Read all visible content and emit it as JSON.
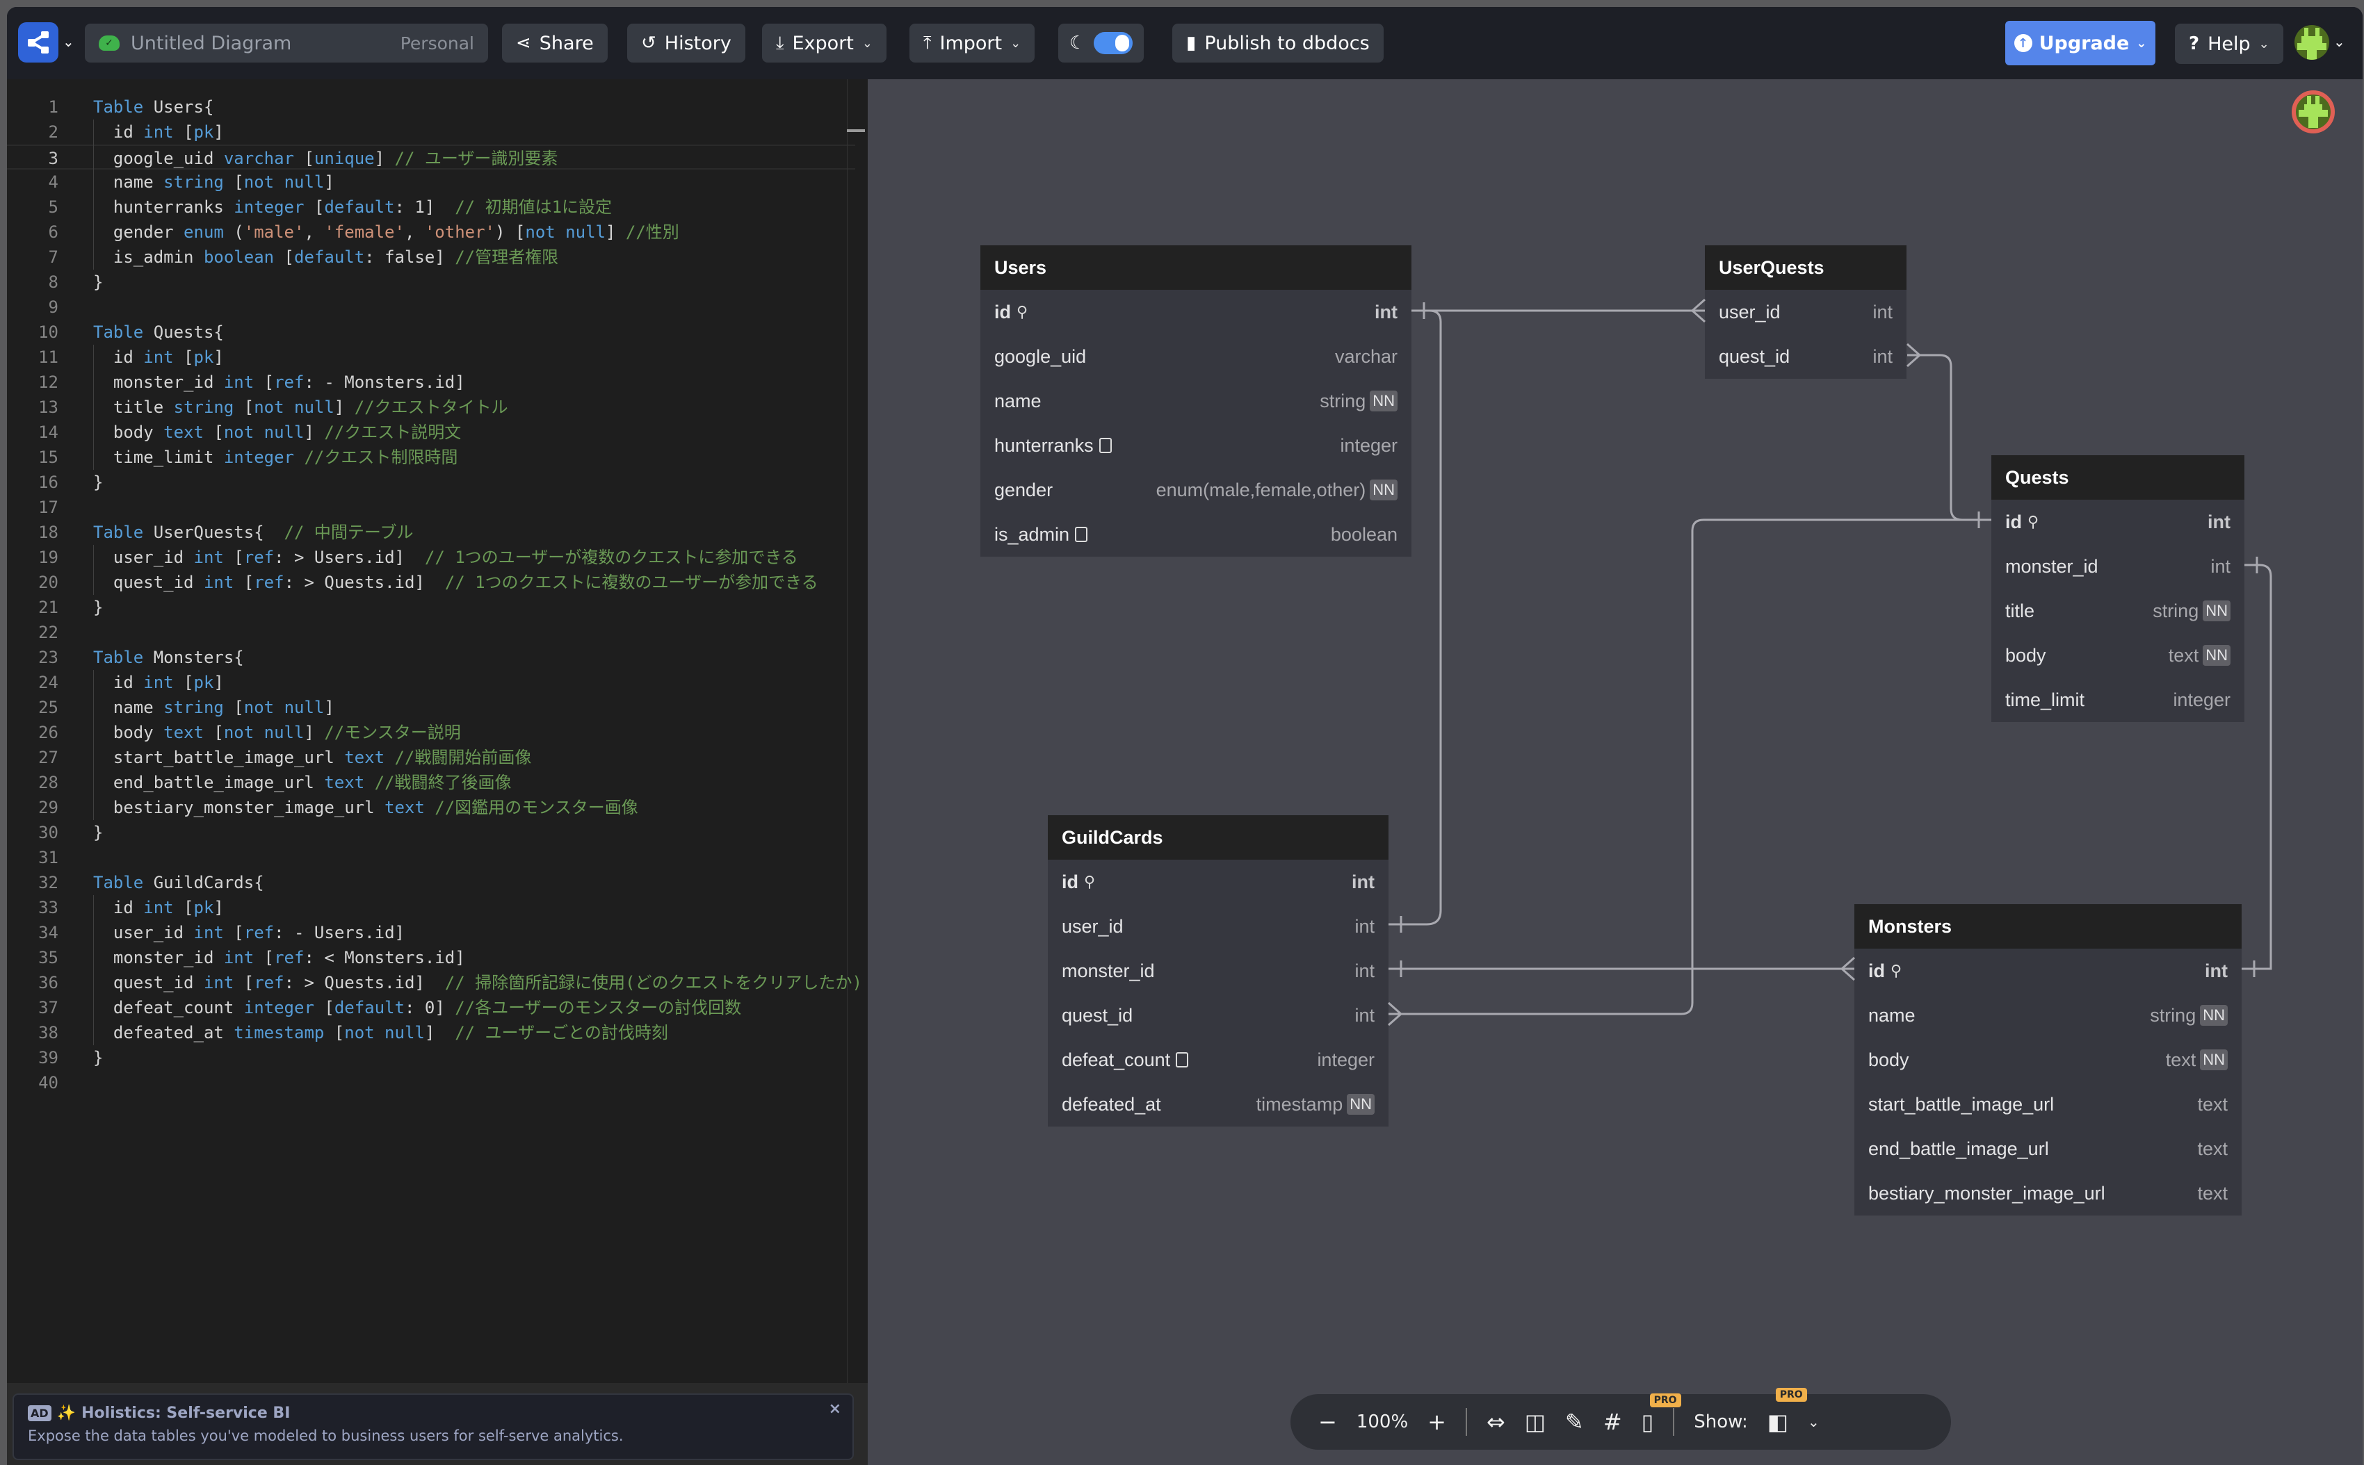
{
  "topbar": {
    "diagram_name": "Untitled Diagram",
    "workspace": "Personal",
    "share_label": "Share",
    "history_label": "History",
    "export_label": "Export",
    "import_label": "Import",
    "publish_label": "Publish to dbdocs",
    "upgrade_label": "Upgrade",
    "help_label": "Help",
    "dark_mode_on": true
  },
  "editor": {
    "current_line": 3,
    "lines": [
      [
        [
          "k",
          "Table"
        ],
        [
          "t",
          " Users{"
        ]
      ],
      [
        [
          "t",
          "  id "
        ],
        [
          "k",
          "int"
        ],
        [
          "t",
          " ["
        ],
        [
          "k",
          "pk"
        ],
        [
          "t",
          "]"
        ]
      ],
      [
        [
          "t",
          "  google_uid "
        ],
        [
          "k",
          "varchar"
        ],
        [
          "t",
          " ["
        ],
        [
          "k",
          "unique"
        ],
        [
          "t",
          "] "
        ],
        [
          "c",
          "// ユーザー識別要素"
        ]
      ],
      [
        [
          "t",
          "  name "
        ],
        [
          "k",
          "string"
        ],
        [
          "t",
          " ["
        ],
        [
          "k",
          "not null"
        ],
        [
          "t",
          "]"
        ]
      ],
      [
        [
          "t",
          "  hunterranks "
        ],
        [
          "k",
          "integer"
        ],
        [
          "t",
          " ["
        ],
        [
          "k",
          "default"
        ],
        [
          "t",
          ": 1]  "
        ],
        [
          "c",
          "// 初期値は1に設定"
        ]
      ],
      [
        [
          "t",
          "  gender "
        ],
        [
          "k",
          "enum"
        ],
        [
          "t",
          " ("
        ],
        [
          "s",
          "'male'"
        ],
        [
          "t",
          ", "
        ],
        [
          "s",
          "'female'"
        ],
        [
          "t",
          ", "
        ],
        [
          "s",
          "'other'"
        ],
        [
          "t",
          ") ["
        ],
        [
          "k",
          "not null"
        ],
        [
          "t",
          "] "
        ],
        [
          "c",
          "//性別"
        ]
      ],
      [
        [
          "t",
          "  is_admin "
        ],
        [
          "k",
          "boolean"
        ],
        [
          "t",
          " ["
        ],
        [
          "k",
          "default"
        ],
        [
          "t",
          ": false] "
        ],
        [
          "c",
          "//管理者権限"
        ]
      ],
      [
        [
          "t",
          "}"
        ]
      ],
      [],
      [
        [
          "k",
          "Table"
        ],
        [
          "t",
          " Quests{"
        ]
      ],
      [
        [
          "t",
          "  id "
        ],
        [
          "k",
          "int"
        ],
        [
          "t",
          " ["
        ],
        [
          "k",
          "pk"
        ],
        [
          "t",
          "]"
        ]
      ],
      [
        [
          "t",
          "  monster_id "
        ],
        [
          "k",
          "int"
        ],
        [
          "t",
          " ["
        ],
        [
          "k",
          "ref"
        ],
        [
          "t",
          ": - Monsters.id]"
        ]
      ],
      [
        [
          "t",
          "  title "
        ],
        [
          "k",
          "string"
        ],
        [
          "t",
          " ["
        ],
        [
          "k",
          "not null"
        ],
        [
          "t",
          "] "
        ],
        [
          "c",
          "//クエストタイトル"
        ]
      ],
      [
        [
          "t",
          "  body "
        ],
        [
          "k",
          "text"
        ],
        [
          "t",
          " ["
        ],
        [
          "k",
          "not null"
        ],
        [
          "t",
          "] "
        ],
        [
          "c",
          "//クエスト説明文"
        ]
      ],
      [
        [
          "t",
          "  time_limit "
        ],
        [
          "k",
          "integer"
        ],
        [
          "t",
          " "
        ],
        [
          "c",
          "//クエスト制限時間"
        ]
      ],
      [
        [
          "t",
          "}"
        ]
      ],
      [],
      [
        [
          "k",
          "Table"
        ],
        [
          "t",
          " UserQuests{  "
        ],
        [
          "c",
          "// 中間テーブル"
        ]
      ],
      [
        [
          "t",
          "  user_id "
        ],
        [
          "k",
          "int"
        ],
        [
          "t",
          " ["
        ],
        [
          "k",
          "ref"
        ],
        [
          "t",
          ": > Users.id]  "
        ],
        [
          "c",
          "// 1つのユーザーが複数のクエストに参加できる"
        ]
      ],
      [
        [
          "t",
          "  quest_id "
        ],
        [
          "k",
          "int"
        ],
        [
          "t",
          " ["
        ],
        [
          "k",
          "ref"
        ],
        [
          "t",
          ": > Quests.id]  "
        ],
        [
          "c",
          "// 1つのクエストに複数のユーザーが参加できる"
        ]
      ],
      [
        [
          "t",
          "}"
        ]
      ],
      [],
      [
        [
          "k",
          "Table"
        ],
        [
          "t",
          " Monsters{"
        ]
      ],
      [
        [
          "t",
          "  id "
        ],
        [
          "k",
          "int"
        ],
        [
          "t",
          " ["
        ],
        [
          "k",
          "pk"
        ],
        [
          "t",
          "]"
        ]
      ],
      [
        [
          "t",
          "  name "
        ],
        [
          "k",
          "string"
        ],
        [
          "t",
          " ["
        ],
        [
          "k",
          "not null"
        ],
        [
          "t",
          "]"
        ]
      ],
      [
        [
          "t",
          "  body "
        ],
        [
          "k",
          "text"
        ],
        [
          "t",
          " ["
        ],
        [
          "k",
          "not null"
        ],
        [
          "t",
          "] "
        ],
        [
          "c",
          "//モンスター説明"
        ]
      ],
      [
        [
          "t",
          "  start_battle_image_url "
        ],
        [
          "k",
          "text"
        ],
        [
          "t",
          " "
        ],
        [
          "c",
          "//戦闘開始前画像"
        ]
      ],
      [
        [
          "t",
          "  end_battle_image_url "
        ],
        [
          "k",
          "text"
        ],
        [
          "t",
          " "
        ],
        [
          "c",
          "//戦闘終了後画像"
        ]
      ],
      [
        [
          "t",
          "  bestiary_monster_image_url "
        ],
        [
          "k",
          "text"
        ],
        [
          "t",
          " "
        ],
        [
          "c",
          "//図鑑用のモンスター画像"
        ]
      ],
      [
        [
          "t",
          "}"
        ]
      ],
      [],
      [
        [
          "k",
          "Table"
        ],
        [
          "t",
          " GuildCards{"
        ]
      ],
      [
        [
          "t",
          "  id "
        ],
        [
          "k",
          "int"
        ],
        [
          "t",
          " ["
        ],
        [
          "k",
          "pk"
        ],
        [
          "t",
          "]"
        ]
      ],
      [
        [
          "t",
          "  user_id "
        ],
        [
          "k",
          "int"
        ],
        [
          "t",
          " ["
        ],
        [
          "k",
          "ref"
        ],
        [
          "t",
          ": - Users.id]"
        ]
      ],
      [
        [
          "t",
          "  monster_id "
        ],
        [
          "k",
          "int"
        ],
        [
          "t",
          " ["
        ],
        [
          "k",
          "ref"
        ],
        [
          "t",
          ": < Monsters.id]"
        ]
      ],
      [
        [
          "t",
          "  quest_id "
        ],
        [
          "k",
          "int"
        ],
        [
          "t",
          " ["
        ],
        [
          "k",
          "ref"
        ],
        [
          "t",
          ": > Quests.id]  "
        ],
        [
          "c",
          "// 掃除箇所記録に使用(どのクエストをクリアしたか)"
        ]
      ],
      [
        [
          "t",
          "  defeat_count "
        ],
        [
          "k",
          "integer"
        ],
        [
          "t",
          " ["
        ],
        [
          "k",
          "default"
        ],
        [
          "t",
          ": 0] "
        ],
        [
          "c",
          "//各ユーザーのモンスターの討伐回数"
        ]
      ],
      [
        [
          "t",
          "  defeated_at "
        ],
        [
          "k",
          "timestamp"
        ],
        [
          "t",
          " ["
        ],
        [
          "k",
          "not null"
        ],
        [
          "t",
          "]  "
        ],
        [
          "c",
          "// ユーザーごとの討伐時刻"
        ]
      ],
      [
        [
          "t",
          "}"
        ]
      ],
      []
    ]
  },
  "ad": {
    "tag": "AD",
    "title": "Holistics: Self-service BI",
    "body": "Expose the data tables you've modeled to business users for self-serve analytics.",
    "close": "×"
  },
  "tables": {
    "users": {
      "name": "Users",
      "fields": [
        {
          "name": "id",
          "type": "int",
          "pk": true
        },
        {
          "name": "google_uid",
          "type": "varchar"
        },
        {
          "name": "name",
          "type": "string",
          "nn": "NN"
        },
        {
          "name": "hunterranks",
          "type": "integer",
          "note": true
        },
        {
          "name": "gender",
          "type": "enum(male,female,other)",
          "nn": "NN"
        },
        {
          "name": "is_admin",
          "type": "boolean",
          "note": true
        }
      ]
    },
    "userquests": {
      "name": "UserQuests",
      "fields": [
        {
          "name": "user_id",
          "type": "int"
        },
        {
          "name": "quest_id",
          "type": "int"
        }
      ]
    },
    "quests": {
      "name": "Quests",
      "fields": [
        {
          "name": "id",
          "type": "int",
          "pk": true
        },
        {
          "name": "monster_id",
          "type": "int"
        },
        {
          "name": "title",
          "type": "string",
          "nn": "NN"
        },
        {
          "name": "body",
          "type": "text",
          "nn": "NN"
        },
        {
          "name": "time_limit",
          "type": "integer"
        }
      ]
    },
    "guildcards": {
      "name": "GuildCards",
      "fields": [
        {
          "name": "id",
          "type": "int",
          "pk": true
        },
        {
          "name": "user_id",
          "type": "int"
        },
        {
          "name": "monster_id",
          "type": "int"
        },
        {
          "name": "quest_id",
          "type": "int"
        },
        {
          "name": "defeat_count",
          "type": "integer",
          "note": true
        },
        {
          "name": "defeated_at",
          "type": "timestamp",
          "nn": "NN"
        }
      ]
    },
    "monsters": {
      "name": "Monsters",
      "fields": [
        {
          "name": "id",
          "type": "int",
          "pk": true
        },
        {
          "name": "name",
          "type": "string",
          "nn": "NN"
        },
        {
          "name": "body",
          "type": "text",
          "nn": "NN"
        },
        {
          "name": "start_battle_image_url",
          "type": "text"
        },
        {
          "name": "end_battle_image_url",
          "type": "text"
        },
        {
          "name": "bestiary_monster_image_url",
          "type": "text"
        }
      ]
    }
  },
  "relationships": [
    {
      "from": "Users.id",
      "to": "UserQuests.user_id",
      "type": "one-to-many"
    },
    {
      "from": "UserQuests.quest_id",
      "to": "Quests.id",
      "type": "many-to-one"
    },
    {
      "from": "Users.id",
      "to": "GuildCards.user_id",
      "type": "one-to-one"
    },
    {
      "from": "Quests.monster_id",
      "to": "Monsters.id",
      "type": "one-to-one"
    },
    {
      "from": "GuildCards.monster_id",
      "to": "Monsters.id",
      "type": "one-to-many"
    },
    {
      "from": "GuildCards.quest_id",
      "to": "Quests.id",
      "type": "many-to-one"
    }
  ],
  "bottombar": {
    "zoom": "100%",
    "show_label": "Show:",
    "pro_badge": "PRO"
  }
}
